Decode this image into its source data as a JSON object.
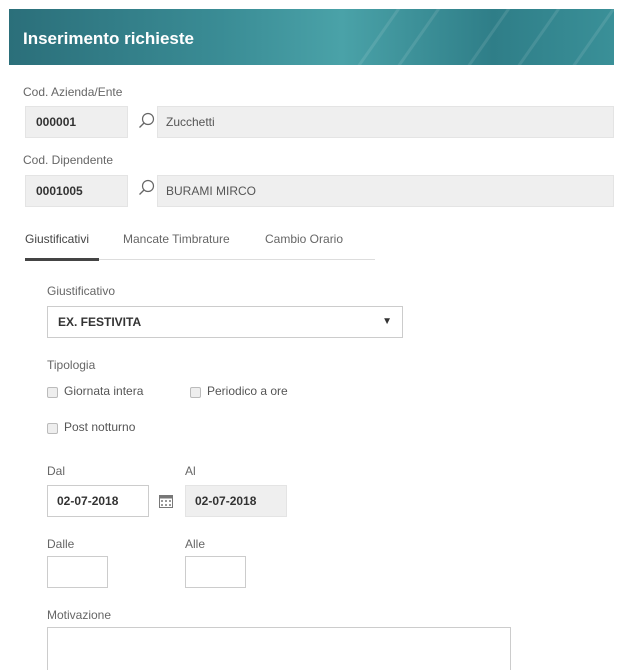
{
  "header": {
    "title": "Inserimento richieste"
  },
  "azienda": {
    "label": "Cod. Azienda/Ente",
    "code": "000001",
    "description": "Zucchetti"
  },
  "dipendente": {
    "label": "Cod. Dipendente",
    "code": "0001005",
    "description": "BURAMI MIRCO"
  },
  "tabs": [
    {
      "label": "Giustificativi",
      "active": true
    },
    {
      "label": "Mancate Timbrature",
      "active": false
    },
    {
      "label": "Cambio Orario",
      "active": false
    }
  ],
  "giustificativo": {
    "label": "Giustificativo",
    "selected": "EX. FESTIVITA",
    "caret": "▼"
  },
  "tipologia": {
    "label": "Tipologia",
    "options": [
      "Giornata intera",
      "Periodico a ore",
      "Post notturno"
    ]
  },
  "dates": {
    "dal_label": "Dal",
    "dal_value": "02-07-2018",
    "al_label": "Al",
    "al_value": "02-07-2018"
  },
  "times": {
    "dalle_label": "Dalle",
    "alle_label": "Alle"
  },
  "motivazione": {
    "label": "Motivazione"
  },
  "icons": {
    "search": "search-icon",
    "calendar": "calendar-icon",
    "dropdown": "caret-down-icon"
  }
}
